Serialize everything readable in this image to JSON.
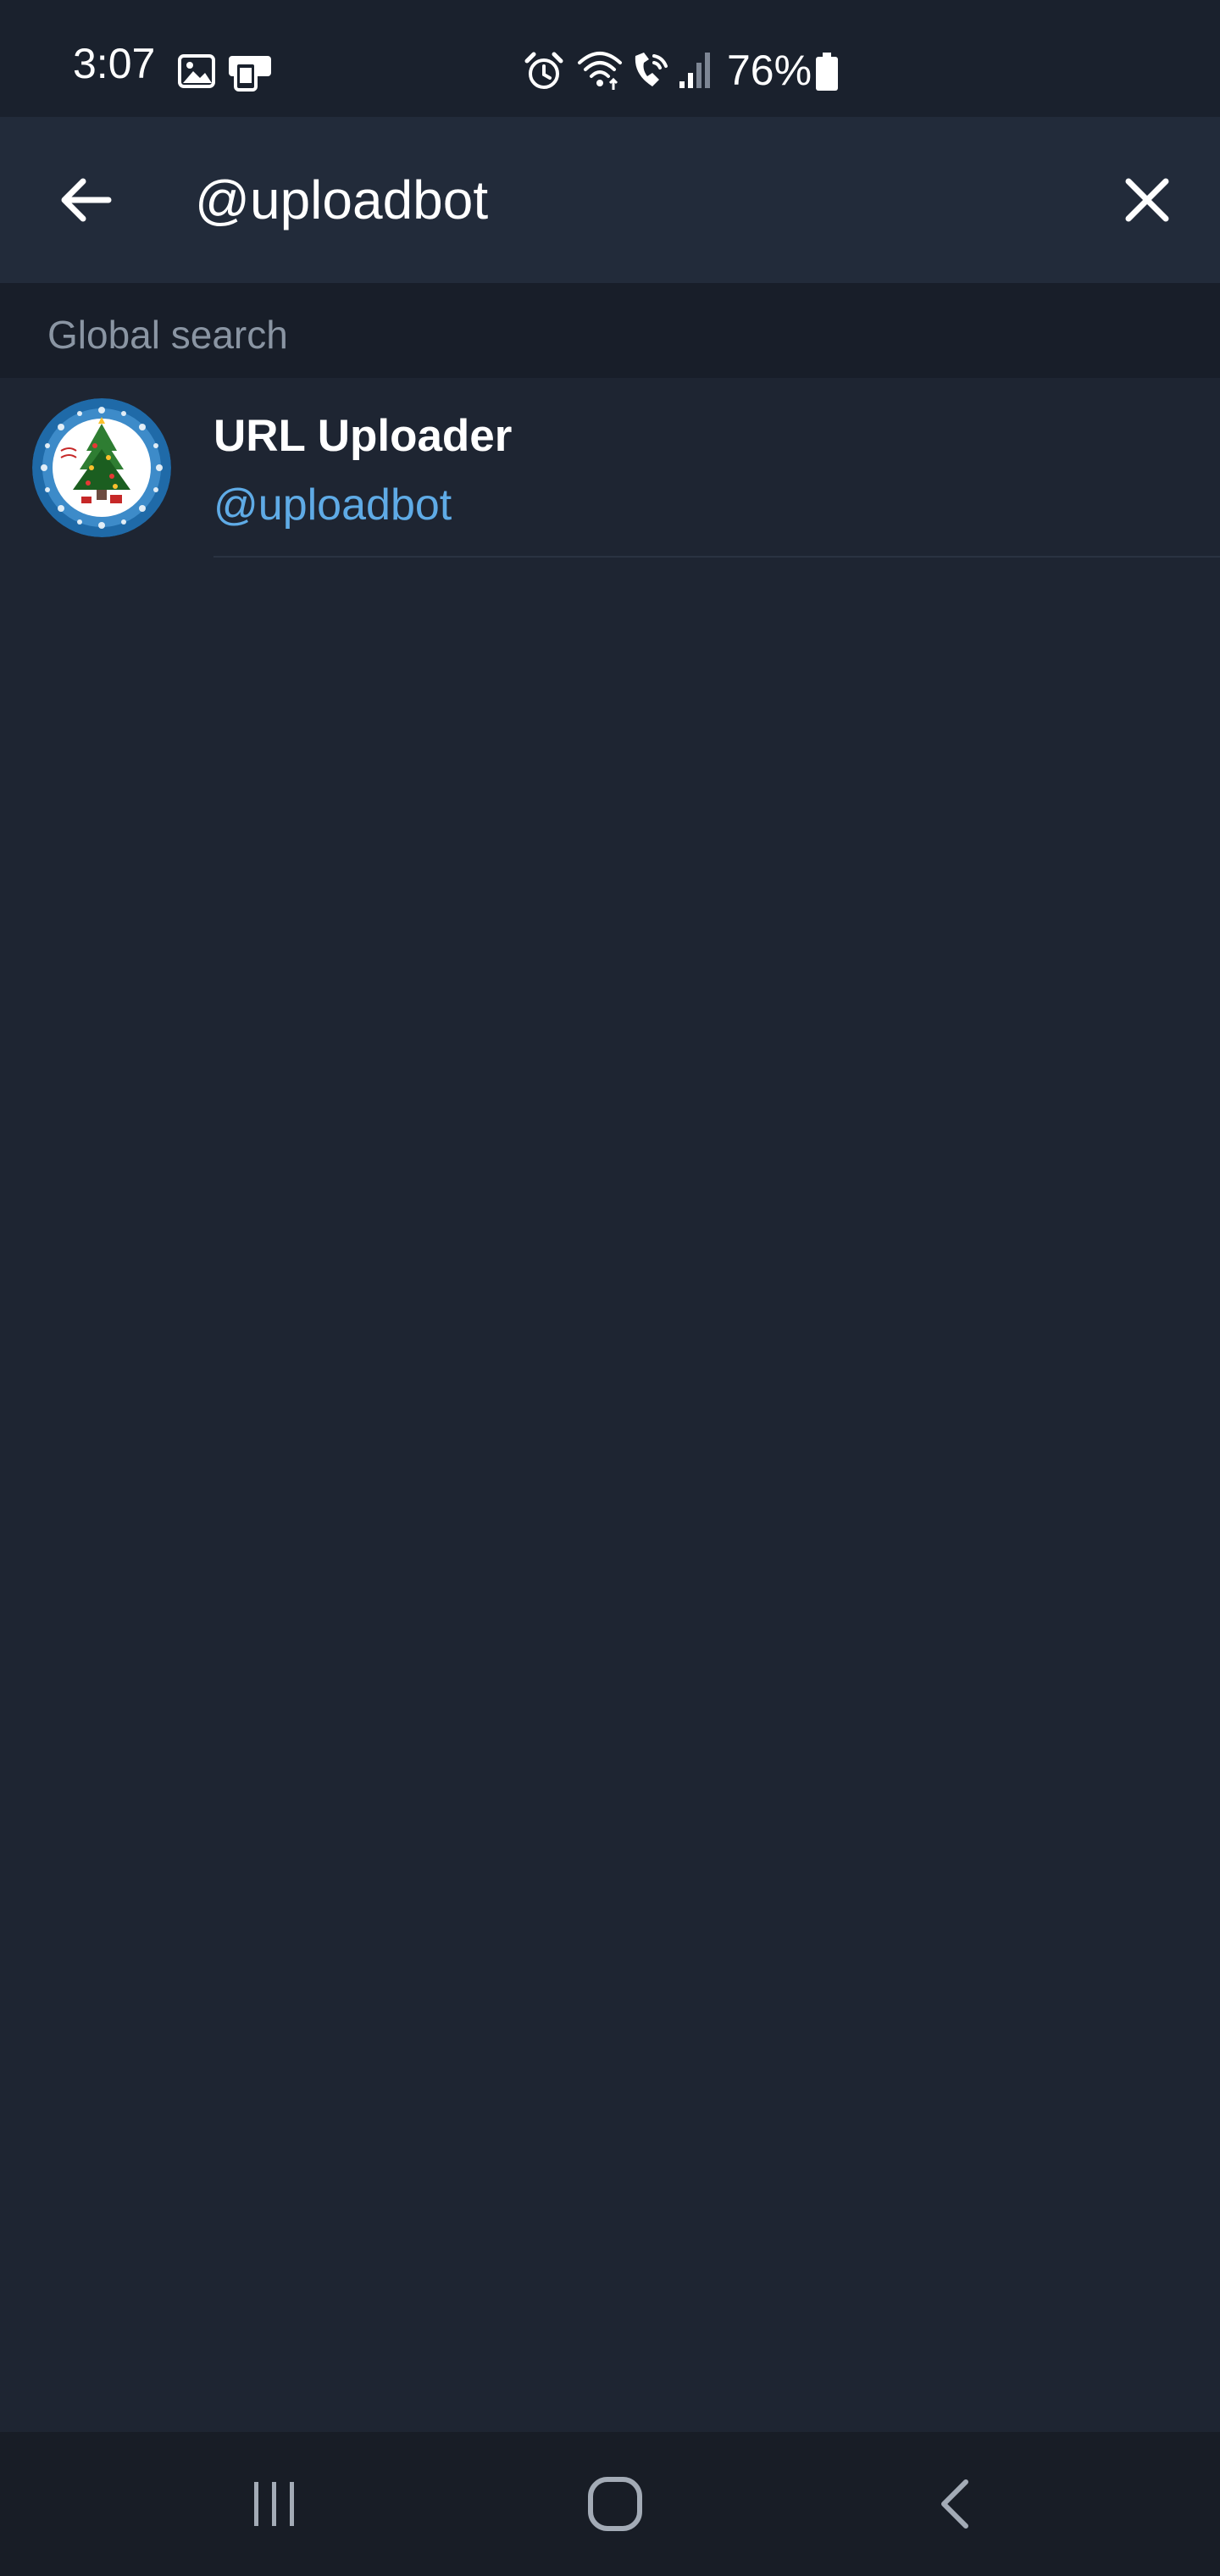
{
  "status_bar": {
    "time": "3:07",
    "battery_percent": "76%",
    "icons": [
      "image-icon",
      "device-icon",
      "alarm-icon",
      "wifi-icon",
      "wifi-call-icon",
      "signal-icon",
      "battery-icon"
    ]
  },
  "search": {
    "query": "@uploadbot",
    "back_icon": "arrow-left-icon",
    "clear_icon": "close-icon"
  },
  "sections": {
    "global_search_label": "Global search"
  },
  "results": [
    {
      "name": "URL Uploader",
      "username": "@uploadbot",
      "avatar": "christmas-tree-avatar"
    }
  ],
  "nav_bar": {
    "buttons": [
      "recents-icon",
      "home-icon",
      "back-icon"
    ]
  },
  "colors": {
    "background": "#1e2532",
    "header": "#222b3a",
    "section_header": "#181e29",
    "username_accent": "#5fabe6",
    "section_text": "#8a95a3"
  }
}
